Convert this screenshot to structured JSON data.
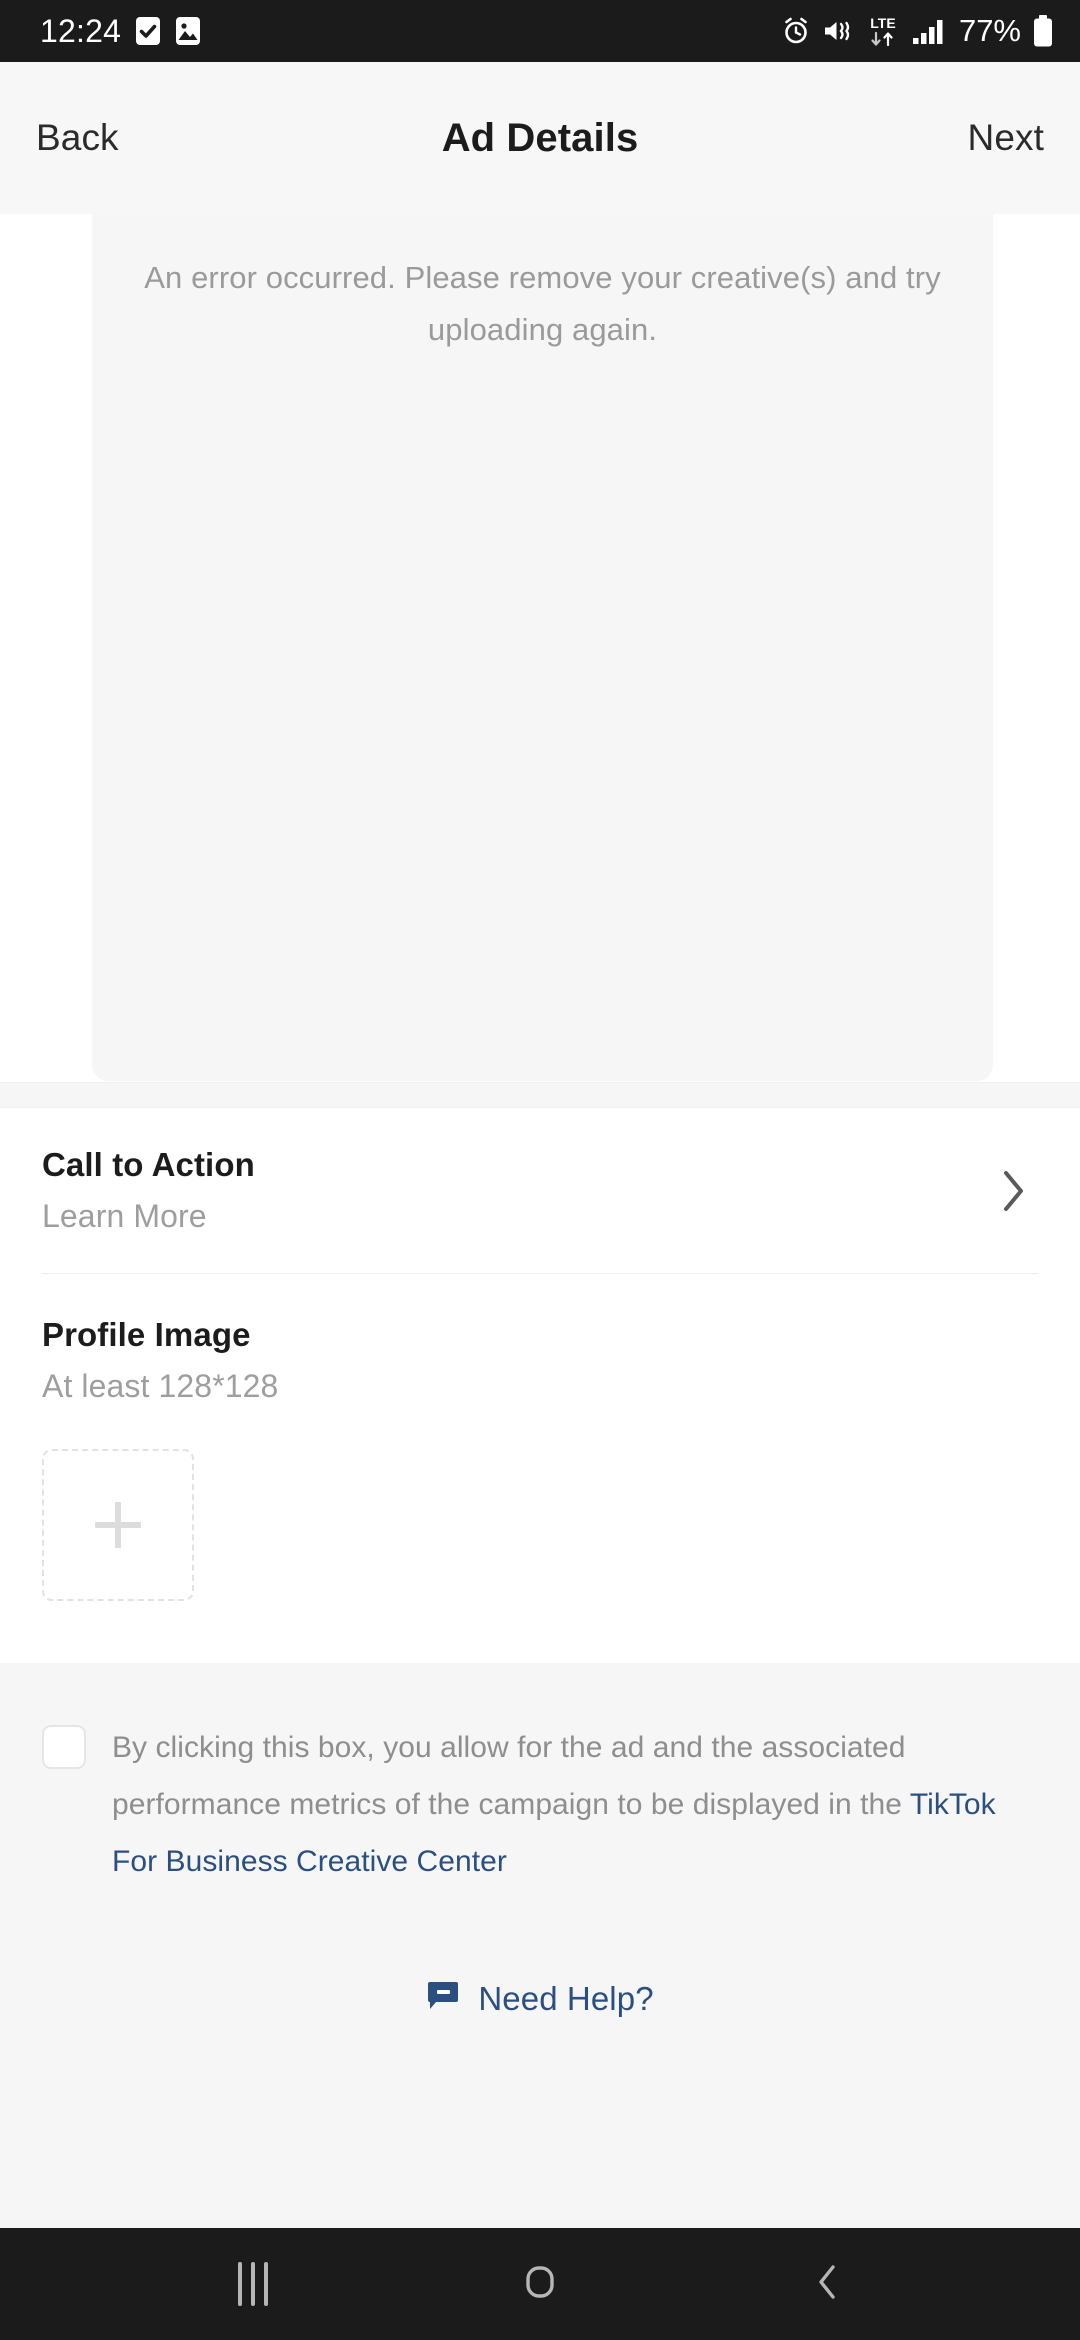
{
  "status_bar": {
    "time": "12:24",
    "left_icons": [
      "tasks-check-icon",
      "gallery-image-icon"
    ],
    "right_icons": [
      "alarm-icon",
      "vibrate-mute-icon",
      "lte-data-icon",
      "signal-bars-icon"
    ],
    "network_label": "LTE",
    "battery_percent": "77%"
  },
  "header": {
    "back_label": "Back",
    "title": "Ad Details",
    "next_label": "Next"
  },
  "creative": {
    "error_message": "An error occurred. Please remove your creative(s) and try uploading again."
  },
  "form": {
    "call_to_action": {
      "title": "Call to Action",
      "value": "Learn More",
      "chevron": "chevron-right-icon"
    },
    "profile_image": {
      "title": "Profile Image",
      "hint": "At least 128*128",
      "upload_glyph": "plus-icon"
    }
  },
  "footer": {
    "consent": {
      "checked": false,
      "text_part_1": "By clicking this box, you allow for the ad and the associated performance metrics of the campaign to be displayed in the ",
      "link_text": "TikTok For Business Creative Center"
    },
    "help": {
      "icon": "chat-bubble-icon",
      "label": "Need Help?"
    }
  },
  "nav_bar": {
    "recents_label": "recents-icon",
    "home_label": "home-icon",
    "back_label": "back-icon"
  },
  "colors": {
    "status_bar_bg": "#1b1b1b",
    "header_bg": "#f7f7f7",
    "card_bg": "#f6f6f6",
    "link_blue": "#2b4f81",
    "muted_text": "#9a9a9a",
    "title_text": "#1c1c1c"
  }
}
